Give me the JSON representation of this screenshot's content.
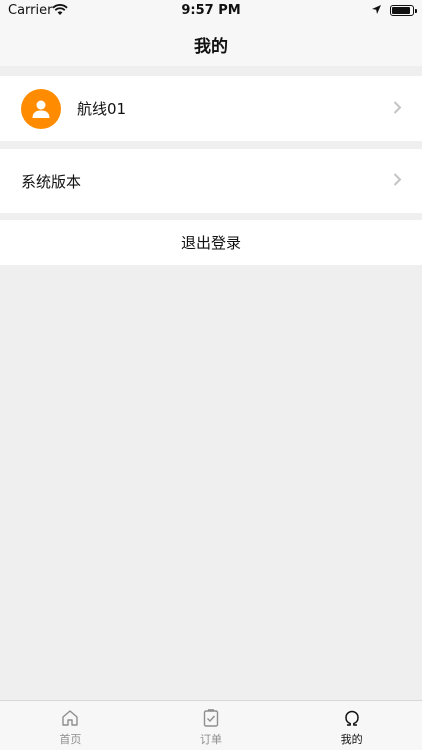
{
  "status_bar": {
    "carrier": "Carrier",
    "time": "9:57 PM",
    "battery_level": 0.9
  },
  "nav": {
    "title": "我的"
  },
  "profile": {
    "name": "航线01",
    "avatar_color": "#ff8c00"
  },
  "settings": {
    "version_label": "系统版本",
    "logout_label": "退出登录"
  },
  "tabs": [
    {
      "label": "首页",
      "icon": "home-icon",
      "active": false
    },
    {
      "label": "订单",
      "icon": "order-icon",
      "active": false
    },
    {
      "label": "我的",
      "icon": "profile-omega-icon",
      "active": true
    }
  ]
}
